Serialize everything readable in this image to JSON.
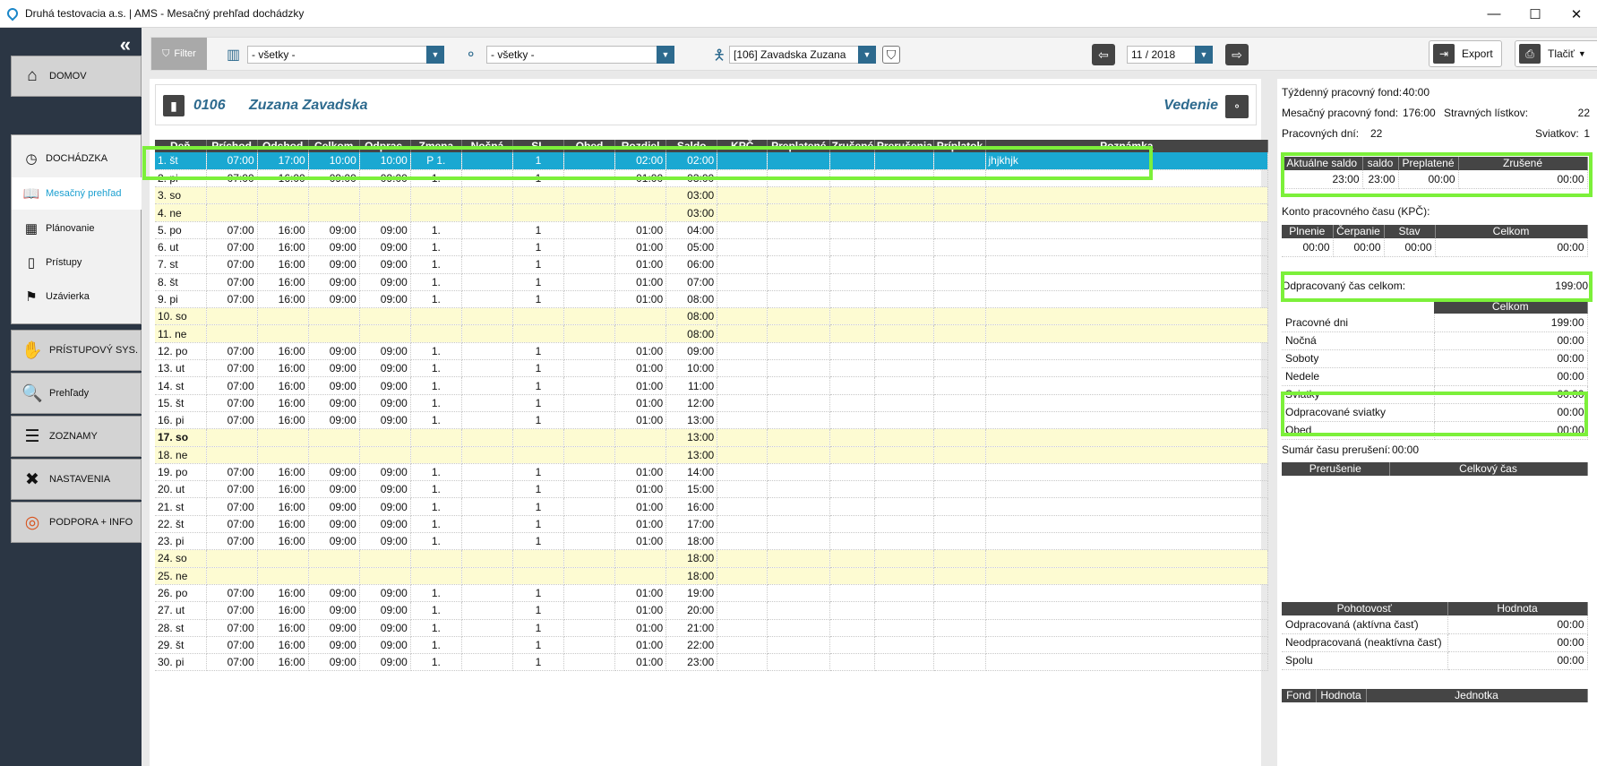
{
  "window": {
    "title": "Druhá testovacia a.s. | AMS - Mesačný prehľad dochádzky",
    "minimize": "—",
    "maximize": "☐",
    "close": "✕"
  },
  "sidebar": {
    "collapse": "«",
    "domov": "DOMOV",
    "dochadzka": "DOCHÁDZKA",
    "subitems": [
      "Mesačný prehľad",
      "Plánovanie",
      "Prístupy",
      "Uzávierka"
    ],
    "nav": [
      "PRÍSTUPOVÝ SYS.",
      "Prehľady",
      "ZOZNAMY",
      "NASTAVENIA",
      "PODPORA + INFO"
    ]
  },
  "toolbar": {
    "filter": "Filter",
    "org": "- všetky -",
    "team": "- všetky -",
    "employee": "[106] Zavadska Zuzana",
    "month": "11 / 2018",
    "export": "Export",
    "print": "Tlačiť"
  },
  "employee": {
    "number": "0106",
    "name": "Zuzana Zavadska",
    "department": "Vedenie"
  },
  "grid": {
    "columns": [
      "Deň",
      "Príchod",
      "Odchod",
      "Celkom",
      "Odprac.",
      "Zmena",
      "Nočná",
      "SL",
      "Obed",
      "Rozdiel",
      "Saldo",
      "KPČ",
      "Preplatené",
      "Zrušené",
      "Prerušenia",
      "Príplatok",
      "Poznámka"
    ],
    "rows": [
      [
        "1. št",
        "07:00",
        "17:00",
        "10:00",
        "10:00",
        "P 1.",
        "",
        "1",
        "",
        "02:00",
        "02:00",
        "",
        "",
        "",
        "",
        "",
        "jhjkhjk"
      ],
      [
        "2. pi",
        "07:00",
        "16:00",
        "09:00",
        "09:00",
        "1.",
        "",
        "1",
        "",
        "01:00",
        "03:00",
        "",
        "",
        "",
        "",
        "",
        ""
      ],
      [
        "3. so",
        "",
        "",
        "",
        "",
        "",
        "",
        "",
        "",
        "",
        "03:00",
        "",
        "",
        "",
        "",
        "",
        ""
      ],
      [
        "4. ne",
        "",
        "",
        "",
        "",
        "",
        "",
        "",
        "",
        "",
        "03:00",
        "",
        "",
        "",
        "",
        "",
        ""
      ],
      [
        "5. po",
        "07:00",
        "16:00",
        "09:00",
        "09:00",
        "1.",
        "",
        "1",
        "",
        "01:00",
        "04:00",
        "",
        "",
        "",
        "",
        "",
        ""
      ],
      [
        "6. ut",
        "07:00",
        "16:00",
        "09:00",
        "09:00",
        "1.",
        "",
        "1",
        "",
        "01:00",
        "05:00",
        "",
        "",
        "",
        "",
        "",
        ""
      ],
      [
        "7. st",
        "07:00",
        "16:00",
        "09:00",
        "09:00",
        "1.",
        "",
        "1",
        "",
        "01:00",
        "06:00",
        "",
        "",
        "",
        "",
        "",
        ""
      ],
      [
        "8. št",
        "07:00",
        "16:00",
        "09:00",
        "09:00",
        "1.",
        "",
        "1",
        "",
        "01:00",
        "07:00",
        "",
        "",
        "",
        "",
        "",
        ""
      ],
      [
        "9. pi",
        "07:00",
        "16:00",
        "09:00",
        "09:00",
        "1.",
        "",
        "1",
        "",
        "01:00",
        "08:00",
        "",
        "",
        "",
        "",
        "",
        ""
      ],
      [
        "10. so",
        "",
        "",
        "",
        "",
        "",
        "",
        "",
        "",
        "",
        "08:00",
        "",
        "",
        "",
        "",
        "",
        ""
      ],
      [
        "11. ne",
        "",
        "",
        "",
        "",
        "",
        "",
        "",
        "",
        "",
        "08:00",
        "",
        "",
        "",
        "",
        "",
        ""
      ],
      [
        "12. po",
        "07:00",
        "16:00",
        "09:00",
        "09:00",
        "1.",
        "",
        "1",
        "",
        "01:00",
        "09:00",
        "",
        "",
        "",
        "",
        "",
        ""
      ],
      [
        "13. ut",
        "07:00",
        "16:00",
        "09:00",
        "09:00",
        "1.",
        "",
        "1",
        "",
        "01:00",
        "10:00",
        "",
        "",
        "",
        "",
        "",
        ""
      ],
      [
        "14. st",
        "07:00",
        "16:00",
        "09:00",
        "09:00",
        "1.",
        "",
        "1",
        "",
        "01:00",
        "11:00",
        "",
        "",
        "",
        "",
        "",
        ""
      ],
      [
        "15. št",
        "07:00",
        "16:00",
        "09:00",
        "09:00",
        "1.",
        "",
        "1",
        "",
        "01:00",
        "12:00",
        "",
        "",
        "",
        "",
        "",
        ""
      ],
      [
        "16. pi",
        "07:00",
        "16:00",
        "09:00",
        "09:00",
        "1.",
        "",
        "1",
        "",
        "01:00",
        "13:00",
        "",
        "",
        "",
        "",
        "",
        ""
      ],
      [
        "17. so",
        "",
        "",
        "",
        "",
        "",
        "",
        "",
        "",
        "",
        "13:00",
        "",
        "",
        "",
        "",
        "",
        ""
      ],
      [
        "18. ne",
        "",
        "",
        "",
        "",
        "",
        "",
        "",
        "",
        "",
        "13:00",
        "",
        "",
        "",
        "",
        "",
        ""
      ],
      [
        "19. po",
        "07:00",
        "16:00",
        "09:00",
        "09:00",
        "1.",
        "",
        "1",
        "",
        "01:00",
        "14:00",
        "",
        "",
        "",
        "",
        "",
        ""
      ],
      [
        "20. ut",
        "07:00",
        "16:00",
        "09:00",
        "09:00",
        "1.",
        "",
        "1",
        "",
        "01:00",
        "15:00",
        "",
        "",
        "",
        "",
        "",
        ""
      ],
      [
        "21. st",
        "07:00",
        "16:00",
        "09:00",
        "09:00",
        "1.",
        "",
        "1",
        "",
        "01:00",
        "16:00",
        "",
        "",
        "",
        "",
        "",
        ""
      ],
      [
        "22. št",
        "07:00",
        "16:00",
        "09:00",
        "09:00",
        "1.",
        "",
        "1",
        "",
        "01:00",
        "17:00",
        "",
        "",
        "",
        "",
        "",
        ""
      ],
      [
        "23. pi",
        "07:00",
        "16:00",
        "09:00",
        "09:00",
        "1.",
        "",
        "1",
        "",
        "01:00",
        "18:00",
        "",
        "",
        "",
        "",
        "",
        ""
      ],
      [
        "24. so",
        "",
        "",
        "",
        "",
        "",
        "",
        "",
        "",
        "",
        "18:00",
        "",
        "",
        "",
        "",
        "",
        ""
      ],
      [
        "25. ne",
        "",
        "",
        "",
        "",
        "",
        "",
        "",
        "",
        "",
        "18:00",
        "",
        "",
        "",
        "",
        "",
        ""
      ],
      [
        "26. po",
        "07:00",
        "16:00",
        "09:00",
        "09:00",
        "1.",
        "",
        "1",
        "",
        "01:00",
        "19:00",
        "",
        "",
        "",
        "",
        "",
        ""
      ],
      [
        "27. ut",
        "07:00",
        "16:00",
        "09:00",
        "09:00",
        "1.",
        "",
        "1",
        "",
        "01:00",
        "20:00",
        "",
        "",
        "",
        "",
        "",
        ""
      ],
      [
        "28. st",
        "07:00",
        "16:00",
        "09:00",
        "09:00",
        "1.",
        "",
        "1",
        "",
        "01:00",
        "21:00",
        "",
        "",
        "",
        "",
        "",
        ""
      ],
      [
        "29. št",
        "07:00",
        "16:00",
        "09:00",
        "09:00",
        "1.",
        "",
        "1",
        "",
        "01:00",
        "22:00",
        "",
        "",
        "",
        "",
        "",
        ""
      ],
      [
        "30. pi",
        "07:00",
        "16:00",
        "09:00",
        "09:00",
        "1.",
        "",
        "1",
        "",
        "01:00",
        "23:00",
        "",
        "",
        "",
        "",
        "",
        ""
      ]
    ],
    "weekend_rows": [
      2,
      3,
      9,
      10,
      16,
      17,
      23,
      24
    ],
    "bold_rows": [
      16
    ],
    "selected_row": 0
  },
  "summary": {
    "tyzdenny_label": "Týždenný pracovný fond:",
    "tyzdenny_value": "40:00",
    "mesacny_label": "Mesačný pracovný fond:",
    "mesacny_value": "176:00",
    "stravne_label": "Stravných lístkov:",
    "stravne_value": "22",
    "pracovne_label": "Pracovných dní:",
    "pracovne_value": "22",
    "sviatkov_label": "Sviatkov:",
    "sviatkov_value": "1",
    "saldo_headers": [
      "Aktuálne saldo",
      "saldo",
      "Preplatené",
      "Zrušené"
    ],
    "saldo_values": [
      "23:00",
      "23:00",
      "00:00",
      "00:00"
    ],
    "kpc_title": "Konto pracovného času (KPČ):",
    "kpc_headers": [
      "Plnenie",
      "Čerpanie",
      "Stav",
      "Celkom"
    ],
    "kpc_values": [
      "00:00",
      "00:00",
      "00:00",
      "00:00"
    ],
    "odprac_label": "Odpracovaný čas celkom:",
    "odprac_value": "199:00",
    "celkom_header": "Celkom",
    "breakdown": [
      [
        "Pracovné dni",
        "199:00"
      ],
      [
        "Nočná",
        "00:00"
      ],
      [
        "Soboty",
        "00:00"
      ],
      [
        "Nedele",
        "00:00"
      ],
      [
        "Sviatky",
        "00:00"
      ],
      [
        "Odpracované sviatky",
        "00:00"
      ],
      [
        "Obed",
        "00:00"
      ]
    ],
    "prerus_label": "Sumár času prerušení:",
    "prerus_value": "00:00",
    "prerus_headers": [
      "Prerušenie",
      "Celkový čas"
    ],
    "pohot_headers": [
      "Pohotovosť",
      "Hodnota"
    ],
    "pohot_rows": [
      [
        "Odpracovaná (aktívna časť)",
        "00:00"
      ],
      [
        "Neodpracovaná (neaktívna časť)",
        "00:00"
      ],
      [
        "Spolu",
        "00:00"
      ]
    ],
    "fond_headers": [
      "Fond",
      "Hodnota",
      "Jednotka"
    ]
  }
}
